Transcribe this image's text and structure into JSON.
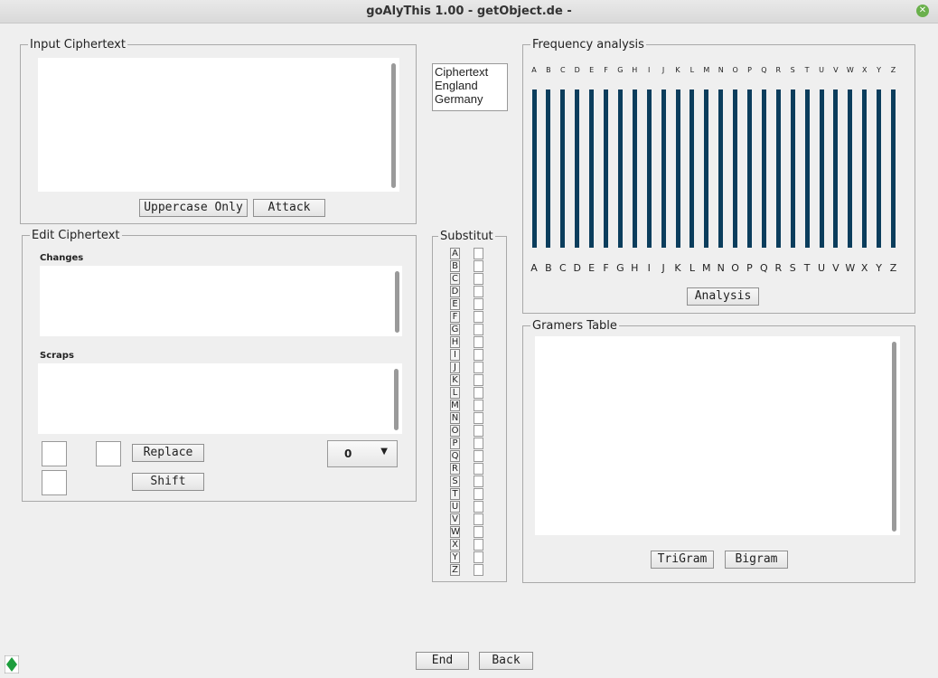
{
  "window": {
    "title": "goAlyThis 1.00 - getObject.de -"
  },
  "input_panel": {
    "legend": "Input Ciphertext",
    "uppercase_label": "Uppercase Only",
    "attack_label": "Attack"
  },
  "languages": {
    "items": [
      "Ciphertext",
      "England",
      "Germany"
    ]
  },
  "edit_panel": {
    "legend": "Edit Ciphertext",
    "changes_label": "Changes",
    "scraps_label": "Scraps",
    "replace_label": "Replace",
    "shift_label": "Shift",
    "dropdown_value": "0"
  },
  "substitut": {
    "legend": "Substitut",
    "letters": [
      "A",
      "B",
      "C",
      "D",
      "E",
      "F",
      "G",
      "H",
      "I",
      "J",
      "K",
      "L",
      "M",
      "N",
      "O",
      "P",
      "Q",
      "R",
      "S",
      "T",
      "U",
      "V",
      "W",
      "X",
      "Y",
      "Z"
    ]
  },
  "frequency": {
    "legend": "Frequency analysis",
    "letters": [
      "A",
      "B",
      "C",
      "D",
      "E",
      "F",
      "G",
      "H",
      "I",
      "J",
      "K",
      "L",
      "M",
      "N",
      "O",
      "P",
      "Q",
      "R",
      "S",
      "T",
      "U",
      "V",
      "W",
      "X",
      "Y",
      "Z"
    ],
    "bar_color": "#0b3d5c",
    "analysis_label": "Analysis"
  },
  "grams": {
    "legend": "Gramers Table",
    "trigram_label": "TriGram",
    "bigram_label": "Bigram"
  },
  "footer": {
    "end_label": "End",
    "back_label": "Back"
  },
  "icons": {
    "close": "close-icon",
    "app": "green-diamond-icon"
  }
}
